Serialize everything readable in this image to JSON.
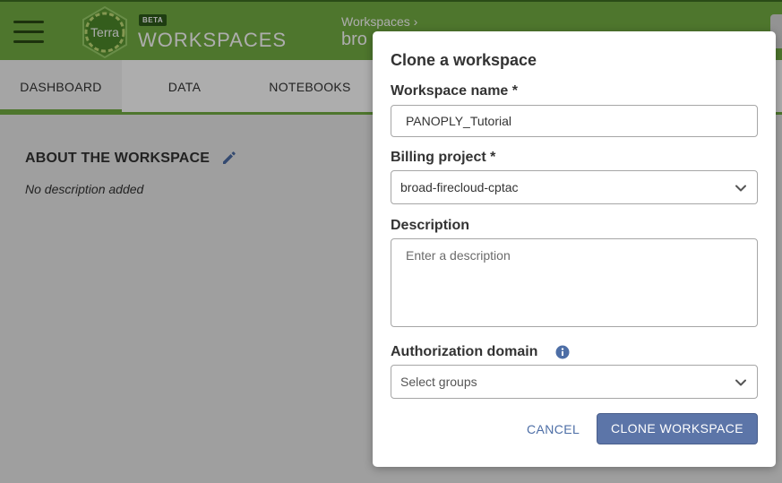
{
  "header": {
    "app_title": "WORKSPACES",
    "badge": "BETA",
    "logo_text": "Terra",
    "breadcrumb": "Workspaces ›",
    "workspace_name": "bro"
  },
  "tabs": [
    {
      "label": "DASHBOARD",
      "active": true
    },
    {
      "label": "DATA",
      "active": false
    },
    {
      "label": "NOTEBOOKS",
      "active": false
    }
  ],
  "dashboard": {
    "section_title": "ABOUT THE WORKSPACE",
    "description": "No description added"
  },
  "modal": {
    "title": "Clone a workspace",
    "workspace_name_label": "Workspace name *",
    "workspace_name_value": "PANOPLY_Tutorial",
    "billing_label": "Billing project *",
    "billing_value": "broad-firecloud-cptac",
    "description_label": "Description",
    "description_placeholder": "Enter a description",
    "auth_label": "Authorization domain",
    "auth_placeholder": "Select groups",
    "cancel_label": "CANCEL",
    "clone_label": "CLONE WORKSPACE"
  },
  "colors": {
    "header_green": "#74ae43",
    "primary_blue": "#5c75a8",
    "link_blue": "#4d6ea6"
  }
}
